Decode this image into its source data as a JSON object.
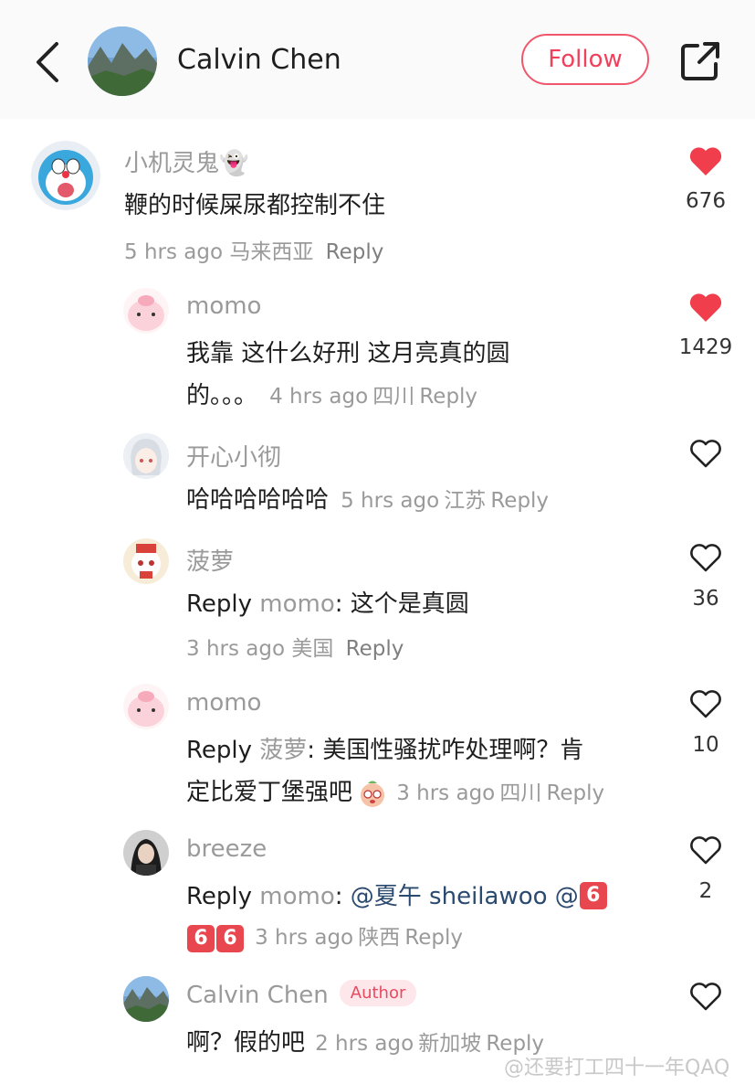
{
  "header": {
    "back_icon": "chevron-left-icon",
    "profile_name": "Calvin Chen",
    "follow_label": "Follow",
    "share_icon": "share-external-icon"
  },
  "colors": {
    "accent": "#f0415c",
    "like_red": "#f03e4c",
    "text_gray": "#9a9a9a"
  },
  "comments": [
    {
      "user": "小机灵鬼👻",
      "text": "鞭的时候屎尿都控制不住",
      "time": "5 hrs ago",
      "location": "马来西亚",
      "reply_label": "Reply",
      "likes": "676",
      "liked": true
    },
    {
      "user": "momo",
      "text_line1": "我靠 这什么好刑  这月亮真的圆",
      "text_line2": "的。。。",
      "time": "4 hrs ago",
      "location": "四川",
      "reply_label": "Reply",
      "likes": "1429",
      "liked": true
    },
    {
      "user": "开心小彻",
      "text": "哈哈哈哈哈哈",
      "time": "5 hrs ago",
      "location": "江苏",
      "reply_label": "Reply",
      "likes": "",
      "liked": false
    },
    {
      "user": "菠萝",
      "reply_prefix": "Reply",
      "reply_to": "momo",
      "text": ": 这个是真圆",
      "time": "3 hrs ago",
      "location": "美国",
      "reply_label": "Reply",
      "likes": "36",
      "liked": false
    },
    {
      "user": "momo",
      "reply_prefix": "Reply",
      "reply_to": "菠萝",
      "text_line1": ": 美国性骚扰咋处理啊？肯",
      "text_line2": "定比爱丁堡强吧",
      "time": "3 hrs ago",
      "location": "四川",
      "reply_label": "Reply",
      "likes": "10",
      "liked": false
    },
    {
      "user": "breeze",
      "reply_prefix": "Reply",
      "reply_to": "momo",
      "colon": ": ",
      "mentions": "@夏午 sheilawoo @",
      "emoji_digit": "6",
      "time": "3 hrs ago",
      "location": "陕西",
      "reply_label": "Reply",
      "likes": "2",
      "liked": false
    },
    {
      "user": "Calvin Chen",
      "badge": "Author",
      "text": "啊？假的吧",
      "time": "2 hrs ago",
      "location": "新加坡",
      "reply_label": "Reply",
      "likes": "",
      "liked": false
    }
  ],
  "watermark": "@还要打工四十一年QAQ"
}
